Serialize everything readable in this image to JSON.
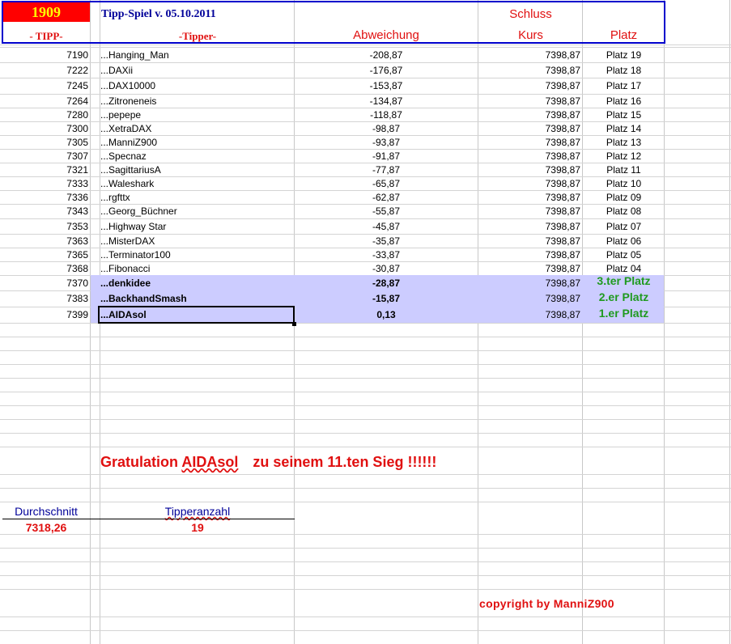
{
  "header": {
    "number": "1909",
    "title": "Tipp-Spiel v. 05.10.2011",
    "schluss": "Schluss",
    "tipp_label": "- TIPP-",
    "tipper_label": "-Tipper-",
    "abweichung_label": "Abweichung",
    "kurs_label": "Kurs",
    "platz_label": "Platz"
  },
  "rows": [
    {
      "tipp": "7190",
      "tipper": "...Hanging_Man",
      "abw": "-208,87",
      "kurs": "7398,87",
      "platz": "Platz 19"
    },
    {
      "tipp": "7222",
      "tipper": "...DAXii",
      "abw": "-176,87",
      "kurs": "7398,87",
      "platz": "Platz 18"
    },
    {
      "tipp": "7245",
      "tipper": "...DAX10000",
      "abw": "-153,87",
      "kurs": "7398,87",
      "platz": "Platz 17"
    },
    {
      "tipp": "7264",
      "tipper": "...Zitroneneis",
      "abw": "-134,87",
      "kurs": "7398,87",
      "platz": "Platz 16"
    },
    {
      "tipp": "7280",
      "tipper": "...pepepe",
      "abw": "-118,87",
      "kurs": "7398,87",
      "platz": "Platz 15"
    },
    {
      "tipp": "7300",
      "tipper": "...XetraDAX",
      "abw": "-98,87",
      "kurs": "7398,87",
      "platz": "Platz 14"
    },
    {
      "tipp": "7305",
      "tipper": "...ManniZ900",
      "abw": "-93,87",
      "kurs": "7398,87",
      "platz": "Platz 13"
    },
    {
      "tipp": "7307",
      "tipper": "...Specnaz",
      "abw": "-91,87",
      "kurs": "7398,87",
      "platz": "Platz 12"
    },
    {
      "tipp": "7321",
      "tipper": "...SagittariusA",
      "abw": "-77,87",
      "kurs": "7398,87",
      "platz": "Platz 11"
    },
    {
      "tipp": "7333",
      "tipper": "...Waleshark",
      "abw": "-65,87",
      "kurs": "7398,87",
      "platz": "Platz 10"
    },
    {
      "tipp": "7336",
      "tipper": "...rgfttx",
      "abw": "-62,87",
      "kurs": "7398,87",
      "platz": "Platz 09"
    },
    {
      "tipp": "7343",
      "tipper": "...Georg_Büchner",
      "abw": "-55,87",
      "kurs": "7398,87",
      "platz": "Platz 08"
    },
    {
      "tipp": "7353",
      "tipper": "...Highway Star",
      "abw": "-45,87",
      "kurs": "7398,87",
      "platz": "Platz 07"
    },
    {
      "tipp": "7363",
      "tipper": "...MisterDAX",
      "abw": "-35,87",
      "kurs": "7398,87",
      "platz": "Platz 06"
    },
    {
      "tipp": "7365",
      "tipper": "...Terminator100",
      "abw": "-33,87",
      "kurs": "7398,87",
      "platz": "Platz 05"
    },
    {
      "tipp": "7368",
      "tipper": "...Fibonacci",
      "abw": "-30,87",
      "kurs": "7398,87",
      "platz": "Platz 04"
    },
    {
      "tipp": "7370",
      "tipper": "...denkidee",
      "abw": "-28,87",
      "kurs": "7398,87",
      "platz": "3.ter Platz",
      "podium": true
    },
    {
      "tipp": "7383",
      "tipper": "...BackhandSmash",
      "abw": "-15,87",
      "kurs": "7398,87",
      "platz": "2.er Platz",
      "podium": true
    },
    {
      "tipp": "7399",
      "tipper": "...AIDAsol",
      "abw": "0,13",
      "kurs": "7398,87",
      "platz": "1.er Platz",
      "podium": true,
      "selected": true
    }
  ],
  "congrats": {
    "part1": "Gratulation",
    "name": "AIDAsol",
    "part2": "zu seinem 11.ten Sieg !!!!!!"
  },
  "stats": {
    "avg_label": "Durchschnitt",
    "avg_value": "7318,26",
    "count_label": "Tipperanzahl",
    "count_value": "19"
  },
  "copyright": "copyright by ManniZ900",
  "colors": {
    "header_number_bg": "#ff0000",
    "header_number_text": "#ffff00",
    "header_border": "#0000cc",
    "title_text": "#000099",
    "red_text": "#e01010",
    "podium_bg": "#ccccff",
    "podium_text": "#1f9a1f",
    "stats_text": "#000099"
  }
}
